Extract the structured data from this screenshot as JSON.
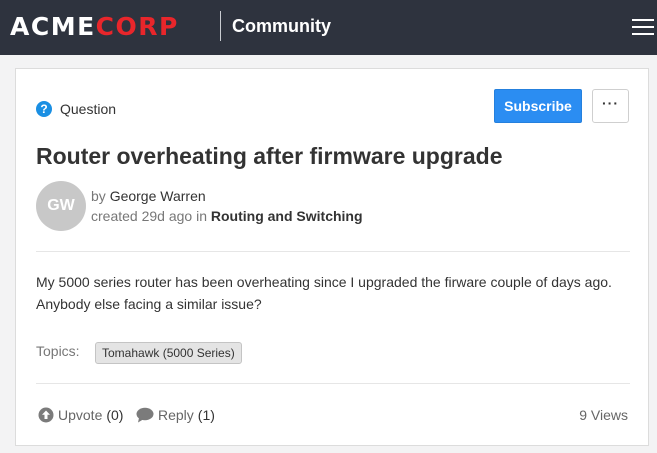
{
  "header": {
    "logo_left": "ACME",
    "logo_right": "CORP",
    "section": "Community",
    "menu_icon": "hamburger-icon"
  },
  "post": {
    "type_icon": "question-circle-icon",
    "type": "Question",
    "subscribe_label": "Subscribe",
    "more_label": "···",
    "title": "Router overheating after firmware upgrade",
    "avatar_initials": "GW",
    "by_label": "by",
    "author": "George Warren",
    "created_label": "created",
    "created_age": "29d ago",
    "in_label": "in",
    "place": "Routing and Switching",
    "body": "My 5000 series router has been overheating since I upgraded the firware couple of days ago. Anybody else facing a similar issue?",
    "topics_label": "Topics:",
    "topics": [
      "Tomahawk (5000 Series)"
    ]
  },
  "footer": {
    "upvote_icon": "arrow-up-circle-icon",
    "upvote_label": "Upvote",
    "upvote_count": "(0)",
    "reply_icon": "speech-bubble-icon",
    "reply_label": "Reply",
    "reply_count": "(1)",
    "views": "9 Views"
  },
  "colors": {
    "topbar": "#2e333e",
    "brand_red": "#e8262b",
    "primary_blue": "#2b8df2"
  }
}
